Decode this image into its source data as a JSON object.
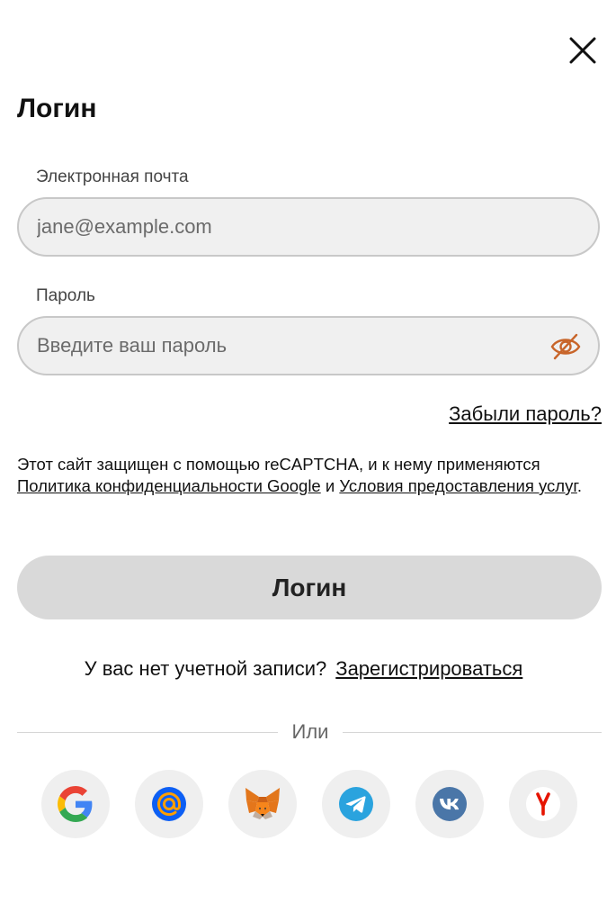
{
  "header": {
    "title": "Логин"
  },
  "email": {
    "label": "Электронная почта",
    "placeholder": "jane@example.com"
  },
  "password": {
    "label": "Пароль",
    "placeholder": "Введите ваш пароль"
  },
  "forgot_link": "Забыли пароль?",
  "recaptcha": {
    "text_before": "Этот сайт защищен с помощью reCAPTCHA, и к нему применяются ",
    "privacy_link": "Политика конфиденциальности Google",
    "and_text": " и ",
    "terms_link": "Условия предоставления услуг",
    "end_text": "."
  },
  "login_button": "Логин",
  "signup": {
    "question": "У вас нет учетной записи?",
    "link": "Зарегистрироваться"
  },
  "divider_text": "Или",
  "social": [
    "google-icon",
    "mail-ru-icon",
    "metamask-icon",
    "telegram-icon",
    "vk-icon",
    "yandex-icon"
  ],
  "colors": {
    "eye_icon": "#c8652a",
    "login_button_bg": "#d9d9d9",
    "field_bg": "#f0f0f0",
    "mail_blue": "#0d5ff4",
    "telegram_blue": "#2aa3de",
    "vk_blue": "#4a76a8",
    "yandex_red": "#e61400"
  }
}
